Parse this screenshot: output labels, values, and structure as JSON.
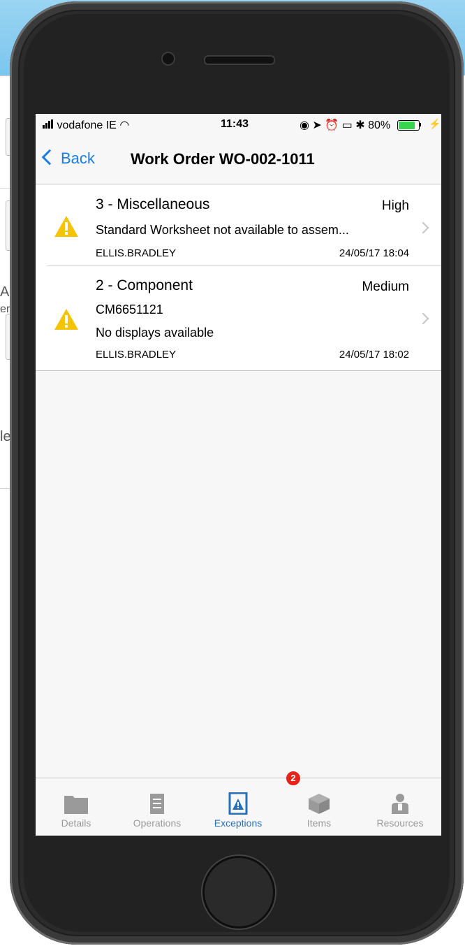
{
  "background_page": {
    "fragments": [
      "A",
      "er",
      "le"
    ]
  },
  "status_bar": {
    "carrier": "vodafone IE",
    "time": "11:43",
    "battery": "80%"
  },
  "nav": {
    "back_label": "Back",
    "title": "Work Order WO-002-1011"
  },
  "exceptions": [
    {
      "title": "3 - Miscellaneous",
      "priority": "High",
      "lines": [
        "Standard Worksheet not available to assem..."
      ],
      "user": "ELLIS.BRADLEY",
      "timestamp": "24/05/17 18:04"
    },
    {
      "title": "2 - Component",
      "priority": "Medium",
      "lines": [
        "CM6651121",
        "No displays available"
      ],
      "user": "ELLIS.BRADLEY",
      "timestamp": "24/05/17 18:02"
    }
  ],
  "tab_bar": {
    "tabs": [
      {
        "label": "Details",
        "icon": "folder-icon"
      },
      {
        "label": "Operations",
        "icon": "list-icon"
      },
      {
        "label": "Exceptions",
        "icon": "exception-icon"
      },
      {
        "label": "Items",
        "icon": "box-icon"
      },
      {
        "label": "Resources",
        "icon": "person-icon"
      }
    ],
    "active": "Exceptions",
    "exceptions_badge": "2"
  },
  "colors": {
    "accent": "#1a7ee0",
    "warning": "#f5c400",
    "badge": "#e5231b",
    "battery": "#38d44c"
  }
}
